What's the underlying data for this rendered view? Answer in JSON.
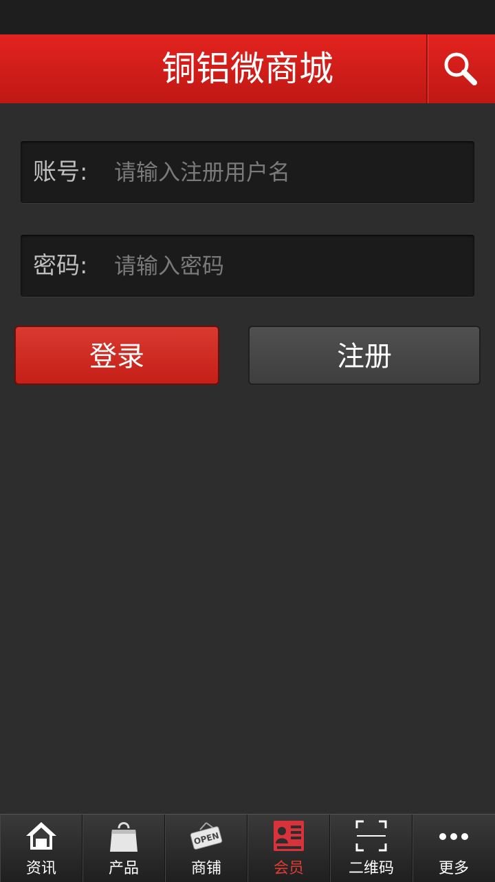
{
  "header": {
    "title": "铜铝微商城",
    "search_icon": "search-icon"
  },
  "login_form": {
    "account": {
      "label": "账号:",
      "placeholder": "请输入注册用户名",
      "value": ""
    },
    "password": {
      "label": "密码:",
      "placeholder": "请输入密码",
      "value": ""
    },
    "login_label": "登录",
    "register_label": "注册"
  },
  "tabbar": {
    "active_tab": "会员",
    "items": [
      {
        "label": "资讯",
        "icon": "home-icon"
      },
      {
        "label": "产品",
        "icon": "shopping-bag-icon"
      },
      {
        "label": "商铺",
        "icon": "open-sign-icon"
      },
      {
        "label": "会员",
        "icon": "member-card-icon"
      },
      {
        "label": "二维码",
        "icon": "qr-scan-icon"
      },
      {
        "label": "更多",
        "icon": "more-dots-icon"
      }
    ]
  },
  "colors": {
    "brand_red": "#d52a22",
    "background": "#2d2d2d",
    "active_tab": "#e23b33"
  }
}
